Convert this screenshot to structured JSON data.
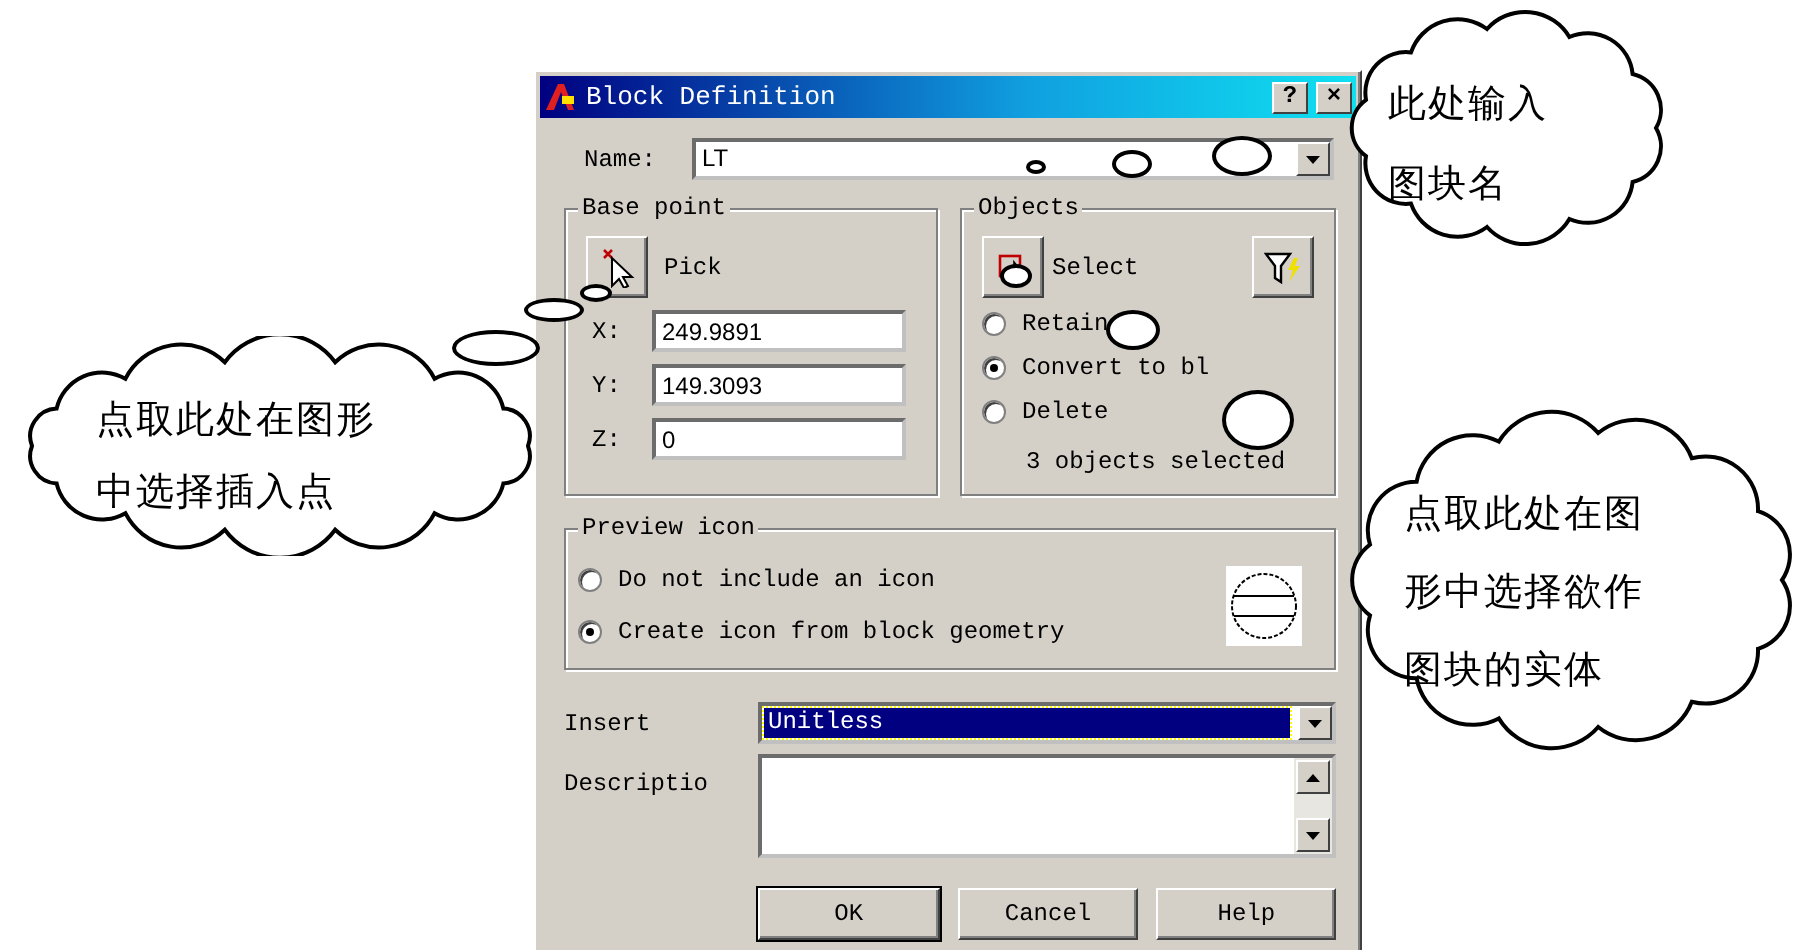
{
  "dialog": {
    "title": "Block Definition",
    "title_buttons": [
      "?",
      "×"
    ],
    "name_label": "Name:",
    "name_value": "LT",
    "base_point": {
      "title": "Base point",
      "pick_label": "Pick",
      "fields": [
        {
          "label": "X:",
          "value": "249.9891"
        },
        {
          "label": "Y:",
          "value": "149.3093"
        },
        {
          "label": "Z:",
          "value": "0"
        }
      ]
    },
    "objects": {
      "title": "Objects",
      "select_label": "Select",
      "options": [
        {
          "label": "Retain",
          "selected": false
        },
        {
          "label": "Convert to bl",
          "selected": true
        },
        {
          "label": "Delete",
          "selected": false
        }
      ],
      "status": "3 objects selected"
    },
    "preview": {
      "title": "Preview icon",
      "options": [
        {
          "label": "Do not include an icon",
          "selected": false
        },
        {
          "label": "Create icon from block geometry",
          "selected": true
        }
      ]
    },
    "insert_label": "Insert",
    "insert_value": "Unitless",
    "description_label": "Descriptio",
    "buttons": [
      "OK",
      "Cancel",
      "Help"
    ]
  },
  "callouts": [
    {
      "lines": [
        "此处输入",
        "图块名"
      ]
    },
    {
      "lines": [
        "点取此处在图形",
        "中选择插入点"
      ]
    },
    {
      "lines": [
        "点取此处在图",
        "形中选择欲作",
        "图块的实体"
      ]
    }
  ]
}
